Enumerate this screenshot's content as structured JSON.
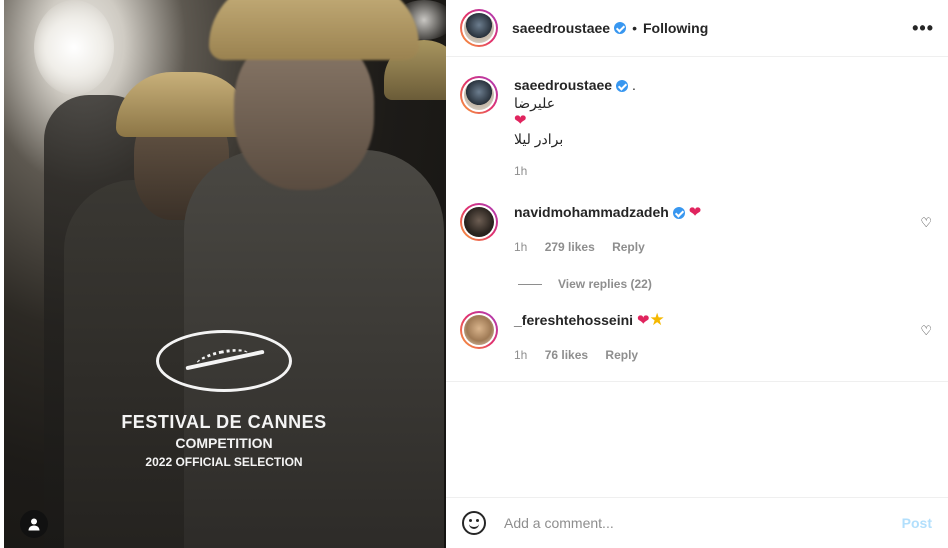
{
  "post_image": {
    "festival_line1": "FESTIVAL DE CANNES",
    "festival_line2": "COMPETITION",
    "festival_line3": "2022 OFFICIAL SELECTION"
  },
  "header": {
    "username": "saeedroustaee",
    "separator": "•",
    "follow_status": "Following",
    "more_label": "•••"
  },
  "caption": {
    "username": "saeedroustaee",
    "trailing": ".",
    "line1": "علیرضا",
    "heart": "❤",
    "line3": "برادر لیلا",
    "time": "1h"
  },
  "comments": [
    {
      "username": "navidmohammadzadeh",
      "text": "❤",
      "time": "1h",
      "likes": "279 likes",
      "reply": "Reply"
    },
    {
      "username": "_fereshtehosseini",
      "text": "❤",
      "star": "★",
      "time": "1h",
      "likes": "76 likes",
      "reply": "Reply"
    }
  ],
  "view_replies": "View replies (22)",
  "footer": {
    "placeholder": "Add a comment...",
    "post_label": "Post"
  },
  "colors": {
    "verified": "#3897f0",
    "heart": "#e0245e",
    "post_disabled": "#b2dffc"
  }
}
